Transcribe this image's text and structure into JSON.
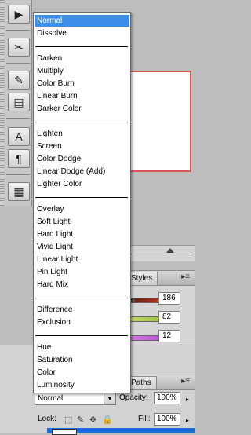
{
  "blend_menu": {
    "items": [
      "Normal",
      "Dissolve",
      "Darken",
      "Multiply",
      "Color Burn",
      "Linear Burn",
      "Darker Color",
      "Lighten",
      "Screen",
      "Color Dodge",
      "Linear Dodge (Add)",
      "Lighter Color",
      "Overlay",
      "Soft Light",
      "Hard Light",
      "Vivid Light",
      "Linear Light",
      "Pin Light",
      "Hard Mix",
      "Difference",
      "Exclusion",
      "Hue",
      "Saturation",
      "Color",
      "Luminosity"
    ],
    "selected": "Normal"
  },
  "toolstrip": {
    "icons": [
      "play-icon",
      "tools-icon",
      "brush-presets-icon",
      "clone-source-icon",
      "character-icon",
      "paragraph-icon",
      "layer-comps-icon"
    ]
  },
  "styles_panel": {
    "tab_label": "Styles",
    "sliders": [
      {
        "value": "186",
        "color": "#d9442a"
      },
      {
        "value": "82",
        "color": "#7fbf27"
      },
      {
        "value": "12",
        "color": "#b13bd6"
      }
    ]
  },
  "layers_panel": {
    "tab_label": "Paths",
    "blend_value": "Normal",
    "opacity_label": "Opacity:",
    "opacity_value": "100%",
    "lock_label": "Lock:",
    "fill_label": "Fill:",
    "fill_value": "100%"
  },
  "colors": {
    "menu_highlight": "#3d8ee9",
    "doc_border": "#dd5555",
    "layer_selected": "#1a6fd8"
  }
}
